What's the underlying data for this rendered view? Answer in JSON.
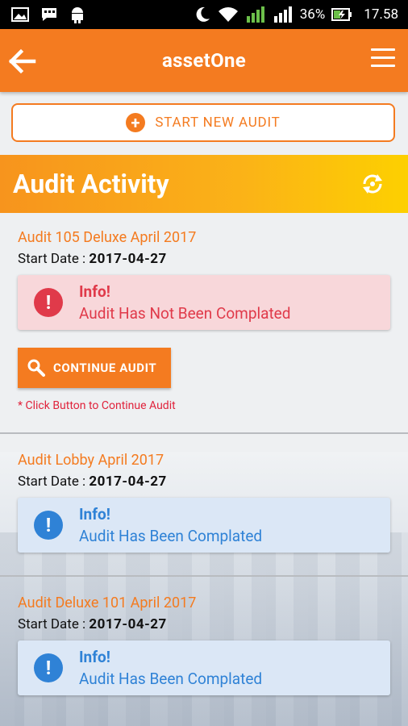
{
  "status_bar": {
    "battery": "36%",
    "time": "17.58",
    "left_icons": [
      "gallery-icon",
      "message-icon",
      "android-icon"
    ],
    "right_icons": [
      "moon-icon",
      "wifi-icon",
      "signal-icon",
      "signal-2-icon",
      "battery-icon"
    ]
  },
  "app_bar": {
    "title": "assetOne"
  },
  "start_button": {
    "label": "START NEW AUDIT"
  },
  "activity": {
    "title": "Audit Activity"
  },
  "audits": [
    {
      "name": "Audit 105 Deluxe April 2017",
      "start_label": "Start Date : ",
      "start_date": "2017-04-27",
      "info_title": "Info!",
      "info_message": "Audit Has Not Been Complated",
      "status": "danger",
      "continue_label": "CONTINUE AUDIT",
      "hint": "* Click Button to Continue Audit"
    },
    {
      "name": "Audit Lobby April 2017",
      "start_label": "Start Date : ",
      "start_date": "2017-04-27",
      "info_title": "Info!",
      "info_message": "Audit Has Been Complated",
      "status": "info"
    },
    {
      "name": "Audit Deluxe 101 April 2017",
      "start_label": "Start Date : ",
      "start_date": "2017-04-27",
      "info_title": "Info!",
      "info_message": "Audit Has Been Complated",
      "status": "info"
    }
  ],
  "colors": {
    "primary": "#f47b20",
    "danger": "#e03a4a",
    "info": "#2f82d6"
  }
}
